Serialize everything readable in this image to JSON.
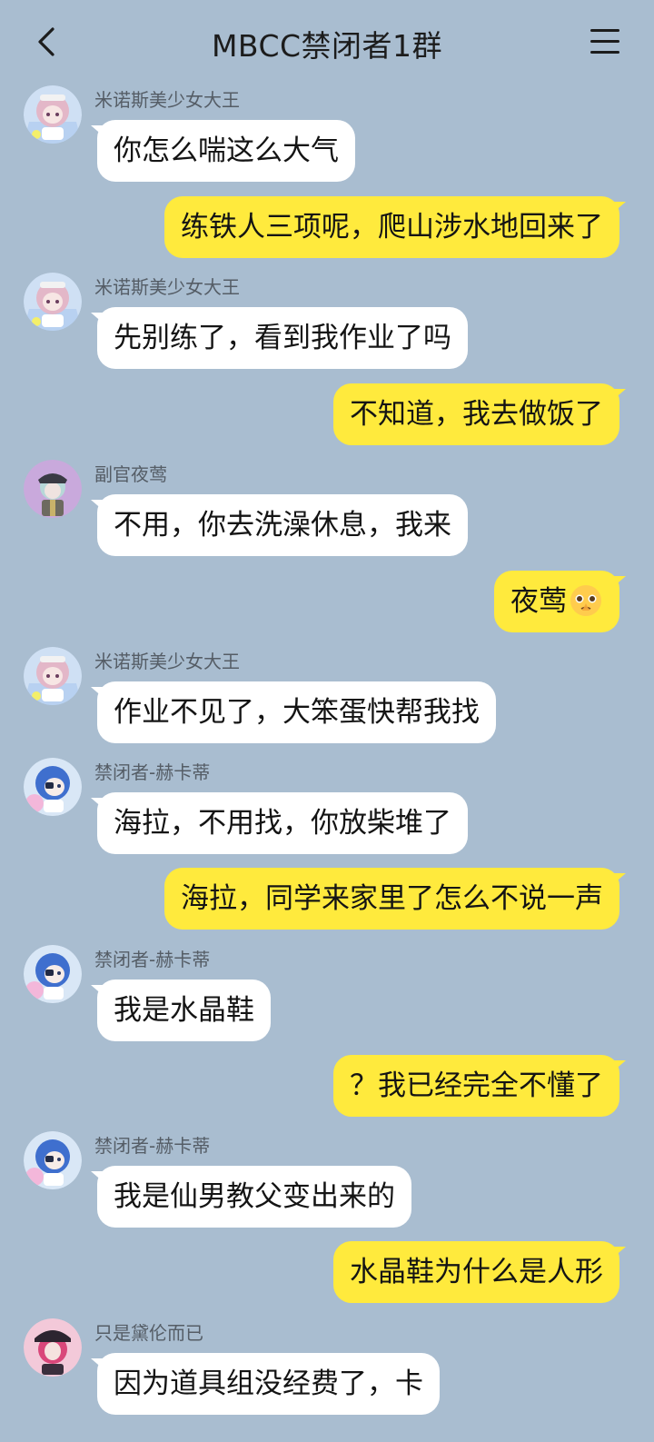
{
  "header": {
    "title": "MBCC禁闭者1群"
  },
  "colors": {
    "background": "#a9bdd0",
    "bubble_self": "#ffea3d",
    "bubble_other": "#ffffff"
  },
  "messages": [
    {
      "side": "left",
      "sender": "米诺斯美少女大王",
      "text": "你怎么喘这么大气",
      "avatar": "pink-hair-girl-avatar"
    },
    {
      "side": "right",
      "text": "练铁人三项呢，爬山涉水地回来了"
    },
    {
      "side": "left",
      "sender": "米诺斯美少女大王",
      "text": "先别练了，看到我作业了吗",
      "avatar": "pink-hair-girl-avatar"
    },
    {
      "side": "right",
      "text": "不知道，我去做饭了"
    },
    {
      "side": "left",
      "sender": "副官夜莺",
      "text": "不用，你去洗澡休息，我来",
      "avatar": "officer-cap-avatar"
    },
    {
      "side": "right",
      "text": "夜莺",
      "emoji": "pleading-face-icon"
    },
    {
      "side": "left",
      "sender": "米诺斯美少女大王",
      "text": "作业不见了，大笨蛋快帮我找",
      "avatar": "pink-hair-girl-avatar"
    },
    {
      "side": "left",
      "sender": "禁闭者-赫卡蒂",
      "text": "海拉，不用找，你放柴堆了",
      "avatar": "blue-hair-eyepatch-avatar"
    },
    {
      "side": "right",
      "text": "海拉，同学来家里了怎么不说一声"
    },
    {
      "side": "left",
      "sender": "禁闭者-赫卡蒂",
      "text": "我是水晶鞋",
      "avatar": "blue-hair-eyepatch-avatar"
    },
    {
      "side": "right",
      "text": "？我已经完全不懂了"
    },
    {
      "side": "left",
      "sender": "禁闭者-赫卡蒂",
      "text": "我是仙男教父变出来的",
      "avatar": "blue-hair-eyepatch-avatar"
    },
    {
      "side": "right",
      "text": "水晶鞋为什么是人形"
    },
    {
      "side": "left",
      "sender": "只是黛伦而已",
      "text": "因为道具组没经费了，卡",
      "avatar": "dark-hat-pink-hair-avatar"
    }
  ]
}
